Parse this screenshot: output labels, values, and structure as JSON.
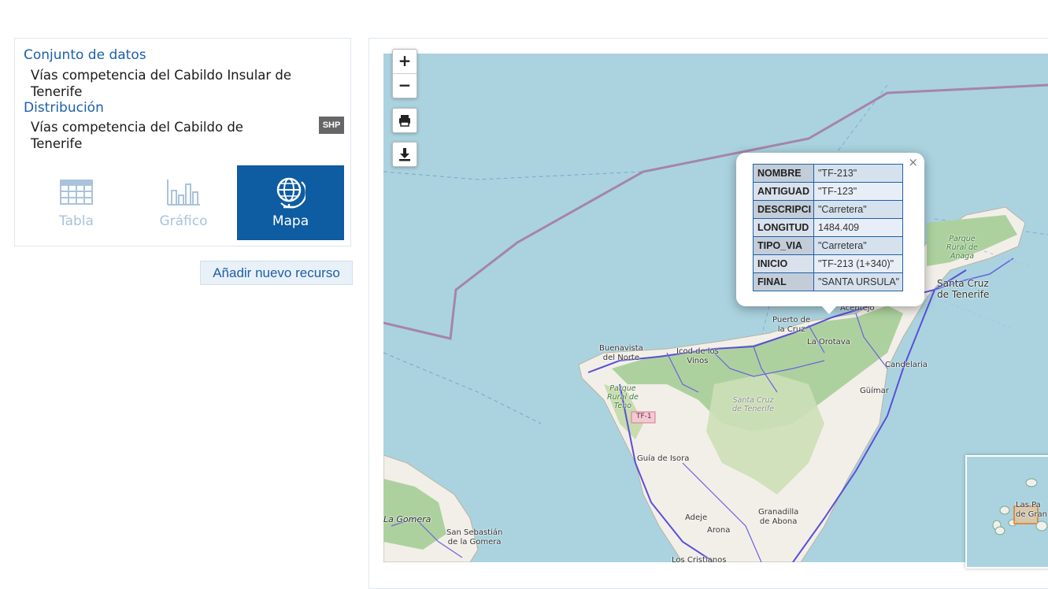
{
  "dataset": {
    "label": "Conjunto de datos",
    "title_line1": "Vías competencia del Cabildo Insular de",
    "title_line2": "Tenerife"
  },
  "distribution": {
    "label": "Distribución",
    "title_line1": "Vías competencia del Cabildo de",
    "title_line2": "Tenerife",
    "format_badge": "SHP"
  },
  "views": {
    "table_label": "Tabla",
    "chart_label": "Gráfico",
    "map_label": "Mapa",
    "active": "map"
  },
  "add_resource_label": "Añadir nuevo recurso",
  "map_controls": {
    "zoom_in": "+",
    "zoom_out": "−"
  },
  "popup": {
    "close": "×",
    "rows": [
      {
        "key": "NOMBRE",
        "value": "\"TF-213\""
      },
      {
        "key": "ANTIGUAD",
        "value": "\"TF-123\""
      },
      {
        "key": "DESCRIPCI",
        "value": "\"Carretera\""
      },
      {
        "key": "LONGITUD",
        "value": "1484.409"
      },
      {
        "key": "TIPO_VIA",
        "value": "\"Carretera\""
      },
      {
        "key": "INICIO",
        "value": "\"TF-213 (1+340)\""
      },
      {
        "key": "FINAL",
        "value": "\"SANTA URSULA\""
      }
    ]
  },
  "map_labels": {
    "santa_cruz_1": "Santa Cruz",
    "santa_cruz_2": "de Tenerife",
    "parque_anaga_1": "Parque",
    "parque_anaga_2": "Rural de",
    "parque_anaga_3": "Anaga",
    "puerto_1": "Puerto de",
    "puerto_2": "la Cruz",
    "acentejo": "Acentejo",
    "la_orotava": "La Orotava",
    "buenavista_1": "Buenavista",
    "buenavista_2": "del Norte",
    "icod_1": "Icod de los",
    "icod_2": "Vinos",
    "candelaria": "Candelaria",
    "guimar": "Güímar",
    "parque_teno_1": "Parque",
    "parque_teno_2": "Rural de",
    "parque_teno_3": "Teno",
    "tf1": "TF-1",
    "santa_cruz_prov_1": "Santa Cruz",
    "santa_cruz_prov_2": "de Tenerife",
    "guia_isora": "Guía de Isora",
    "la_gomera": "La Gomera",
    "san_sebastian_1": "San Sebastián",
    "san_sebastian_2": "de la Gomera",
    "adeje": "Adeje",
    "granadilla_1": "Granadilla",
    "granadilla_2": "de Abona",
    "arona": "Arona",
    "los_cristianos": "Los Cristianos",
    "minimap_label_1": "Las Pa",
    "minimap_label_2": "de Gran"
  },
  "colors": {
    "accent": "#0e5ca1",
    "link": "#1e5fa8",
    "sea": "#aad3df",
    "road": "#5a4fd8"
  }
}
